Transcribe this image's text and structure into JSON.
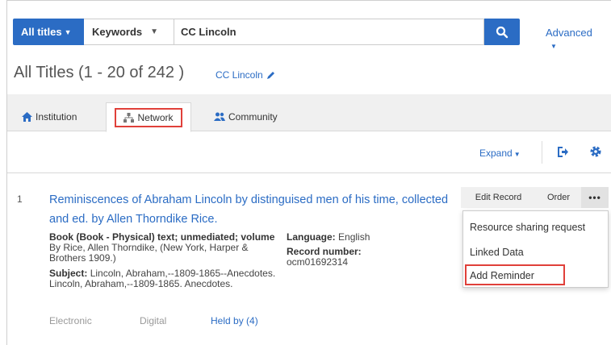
{
  "search": {
    "scope_label": "All titles",
    "field_label": "Keywords",
    "query_value": "CC Lincoln",
    "advanced_label": "Advanced"
  },
  "results": {
    "title": "All Titles (1 - 20 of 242 )",
    "query_link": "CC Lincoln"
  },
  "tabs": [
    {
      "label": "Institution",
      "icon": "home-icon"
    },
    {
      "label": "Network",
      "icon": "network-icon",
      "active": true
    },
    {
      "label": "Community",
      "icon": "users-icon"
    }
  ],
  "toolbar": {
    "expand_label": "Expand"
  },
  "record": {
    "number": "1",
    "title": "Reminiscences of Abraham Lincoln by distinguised men of his time, collected and ed. by Allen Thorndike Rice.",
    "type_label": "Book (Book - Physical) text; unmediated; volume",
    "type_value": "By Rice, Allen Thorndike, (New York, Harper & Brothers 1909.)",
    "subject_label": "Subject:",
    "subject_value": "Lincoln, Abraham,--1809-1865--Anecdotes. Lincoln, Abraham,--1809-1865. Anecdotes.",
    "language_label": "Language:",
    "language_value": "English",
    "record_number_label": "Record number:",
    "record_number_value": "ocm01692314",
    "availability": {
      "electronic": "Electronic",
      "digital": "Digital",
      "held_by": "Held by (4)"
    },
    "actions": {
      "edit": "Edit Record",
      "order": "Order",
      "more": "•••"
    }
  },
  "dropdown": {
    "items": [
      "Resource sharing request",
      "Linked Data",
      "Add Reminder"
    ]
  },
  "colors": {
    "accent": "#2b6cc4",
    "highlight": "#e0403a"
  }
}
